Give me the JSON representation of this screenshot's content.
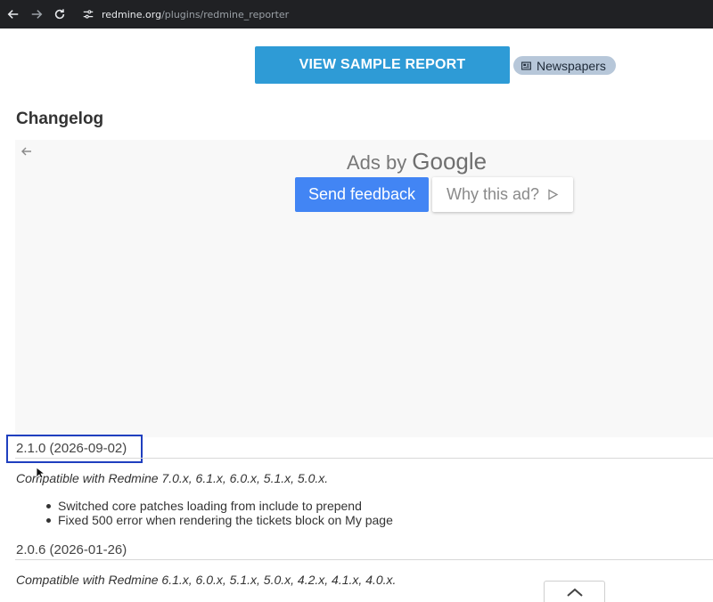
{
  "browser": {
    "url_domain": "redmine.org",
    "url_path": "/plugins/redmine_reporter"
  },
  "main": {
    "sample_report_label": "VIEW SAMPLE REPORT",
    "tag_label": "Newspapers",
    "changelog_title": "Changelog"
  },
  "ad": {
    "ads_by": "Ads by",
    "google": "Google",
    "send_feedback": "Send feedback",
    "why_this_ad": "Why this ad?"
  },
  "releases": [
    {
      "version": "2.1.0 (2026-09-02)",
      "compat": "Compatible with Redmine 7.0.x, 6.1.x, 6.0.x, 5.1.x, 5.0.x.",
      "items": [
        "Switched core patches loading from include to prepend",
        "Fixed 500 error when rendering the tickets block on My page"
      ]
    },
    {
      "version": "2.0.6 (2026-01-26)",
      "compat": "Compatible with Redmine 6.1.x, 6.0.x, 5.1.x, 5.0.x, 4.2.x, 4.1.x, 4.0.x."
    }
  ],
  "colors": {
    "accent": "#2e9bd6",
    "google_blue": "#4285f4",
    "focus": "#1f3fbf"
  }
}
